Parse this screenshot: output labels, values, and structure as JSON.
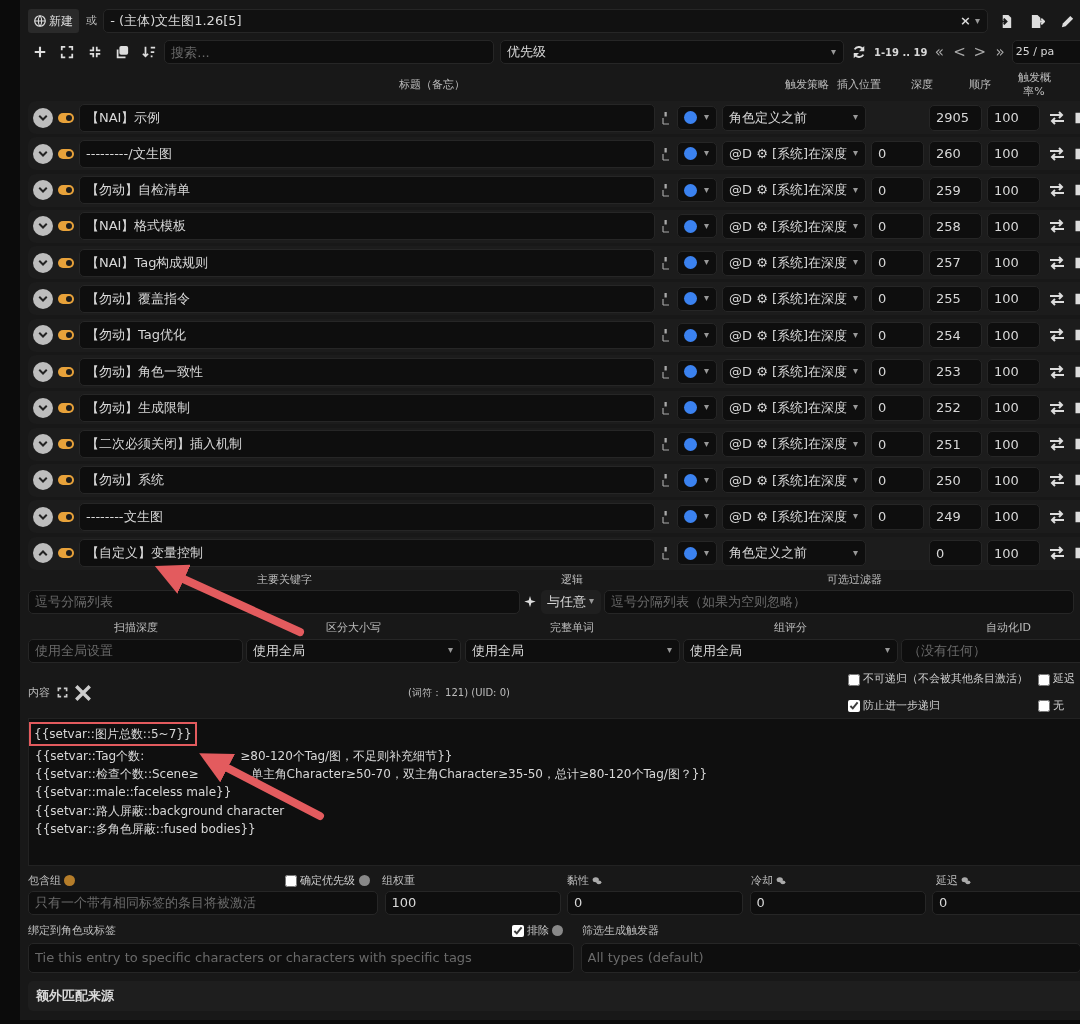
{
  "header": {
    "new_button": "新建",
    "or_label": "或",
    "world_select": "- (主体)文生图1.26[5]",
    "clear": "×"
  },
  "toolbar": {
    "search_placeholder": "搜索...",
    "sort": "优先级",
    "range": "1-19 .. 19",
    "first": "«",
    "prev": "<",
    "next": ">",
    "last": "»",
    "page_size": "25 / pa"
  },
  "columns": [
    "标题（备忘）",
    "触发策略",
    "插入位置",
    "深度",
    "顺序",
    "触发概率%"
  ],
  "entries": [
    {
      "title": "【NAI】示例",
      "enabled": true,
      "expanded": false,
      "position": "角色定义之前",
      "order": "2905",
      "probability": "100"
    },
    {
      "title": "---------/文生图",
      "enabled": true,
      "expanded": false,
      "position": "@D ⚙ [系统]在深度",
      "depth": "0",
      "order": "260",
      "probability": "100"
    },
    {
      "title": "【勿动】自检清单",
      "enabled": true,
      "expanded": false,
      "position": "@D ⚙ [系统]在深度",
      "depth": "0",
      "order": "259",
      "probability": "100"
    },
    {
      "title": "【NAI】格式模板",
      "enabled": true,
      "expanded": false,
      "position": "@D ⚙ [系统]在深度",
      "depth": "0",
      "order": "258",
      "probability": "100"
    },
    {
      "title": "【NAI】Tag构成规则",
      "enabled": true,
      "expanded": false,
      "position": "@D ⚙ [系统]在深度",
      "depth": "0",
      "order": "257",
      "probability": "100"
    },
    {
      "title": "【勿动】覆盖指令",
      "enabled": true,
      "expanded": false,
      "position": "@D ⚙ [系统]在深度",
      "depth": "0",
      "order": "255",
      "probability": "100"
    },
    {
      "title": "【勿动】Tag优化",
      "enabled": true,
      "expanded": false,
      "position": "@D ⚙ [系统]在深度",
      "depth": "0",
      "order": "254",
      "probability": "100"
    },
    {
      "title": "【勿动】角色一致性",
      "enabled": true,
      "expanded": false,
      "position": "@D ⚙ [系统]在深度",
      "depth": "0",
      "order": "253",
      "probability": "100"
    },
    {
      "title": "【勿动】生成限制",
      "enabled": true,
      "expanded": false,
      "position": "@D ⚙ [系统]在深度",
      "depth": "0",
      "order": "252",
      "probability": "100"
    },
    {
      "title": "【二次必须关闭】插入机制",
      "enabled": true,
      "expanded": false,
      "position": "@D ⚙ [系统]在深度",
      "depth": "0",
      "order": "251",
      "probability": "100"
    },
    {
      "title": "【勿动】系统",
      "enabled": true,
      "expanded": false,
      "position": "@D ⚙ [系统]在深度",
      "depth": "0",
      "order": "250",
      "probability": "100"
    },
    {
      "title": "--------文生图",
      "enabled": true,
      "expanded": false,
      "position": "@D ⚙ [系统]在深度",
      "depth": "0",
      "order": "249",
      "probability": "100"
    },
    {
      "title": "【自定义】变量控制",
      "enabled": true,
      "expanded": true,
      "position": "角色定义之前",
      "order": "0",
      "probability": "100"
    }
  ],
  "detail": {
    "keywords": {
      "label": "主要关键字",
      "placeholder": "逗号分隔列表"
    },
    "logic": {
      "label": "逻辑",
      "value": "与任意"
    },
    "filter": {
      "label": "可选过滤器",
      "placeholder": "逗号分隔列表（如果为空则忽略）"
    },
    "settings": [
      {
        "label": "扫描深度",
        "kind": "input",
        "placeholder": "使用全局设置"
      },
      {
        "label": "区分大小写",
        "kind": "select",
        "value": "使用全局"
      },
      {
        "label": "完整单词",
        "kind": "select",
        "value": "使用全局"
      },
      {
        "label": "组评分",
        "kind": "select",
        "value": "使用全局"
      },
      {
        "label": "自动化ID",
        "kind": "input",
        "placeholder": "（没有任何）"
      }
    ],
    "content_label": "内容",
    "token_info": "(词符： 121) (UID: 0)",
    "flags": [
      {
        "label": "不可递归（不会被其他条目激活）",
        "checked": false
      },
      {
        "label": "延迟",
        "checked": false
      },
      {
        "label": "防止进一步递归",
        "checked": true
      },
      {
        "label": "无",
        "checked": false
      }
    ],
    "content_lines": [
      {
        "highlighted": true,
        "parts": [
          "{{setvar::图片总数::5~7}}"
        ]
      },
      {
        "highlighted": false,
        "parts": [
          "{{setvar::Tag个数:",
          "≥80-120个Tag/图，不足则补充细节}}"
        ]
      },
      {
        "highlighted": false,
        "parts": [
          "{{setvar::检查个数::Scene≥",
          "单主角Character≥50-70，双主角Character≥35-50，总计≥80-120个Tag/图？}}"
        ]
      },
      {
        "highlighted": false,
        "parts": [
          "{{setvar::male::faceless male}}"
        ]
      },
      {
        "highlighted": false,
        "parts": [
          "{{setvar::路人屏蔽::background character"
        ]
      },
      {
        "highlighted": false,
        "parts": [
          "{{setvar::多角色屏蔽::fused bodies}}"
        ]
      }
    ],
    "group": {
      "label": "包含组",
      "placeholder": "只有一个带有相同标签的条目将被激活",
      "prioritize": {
        "label": "确定优先级",
        "checked": false
      }
    },
    "numbers": [
      {
        "label": "组权重",
        "kind": "plain",
        "value": "100"
      },
      {
        "label": "黏性",
        "kind": "timed",
        "value": "0"
      },
      {
        "label": "冷却",
        "kind": "timed",
        "value": "0"
      },
      {
        "label": "延迟",
        "kind": "timed",
        "value": "0"
      }
    ],
    "bind": {
      "label": "绑定到角色或标签",
      "placeholder": "Tie this entry to specific characters or characters with specific tags",
      "exclude": {
        "label": "排除",
        "checked": true
      }
    },
    "trigger_filter": {
      "label": "筛选生成触发器",
      "placeholder": "All types (default)"
    },
    "extra_sources": "额外匹配来源"
  }
}
